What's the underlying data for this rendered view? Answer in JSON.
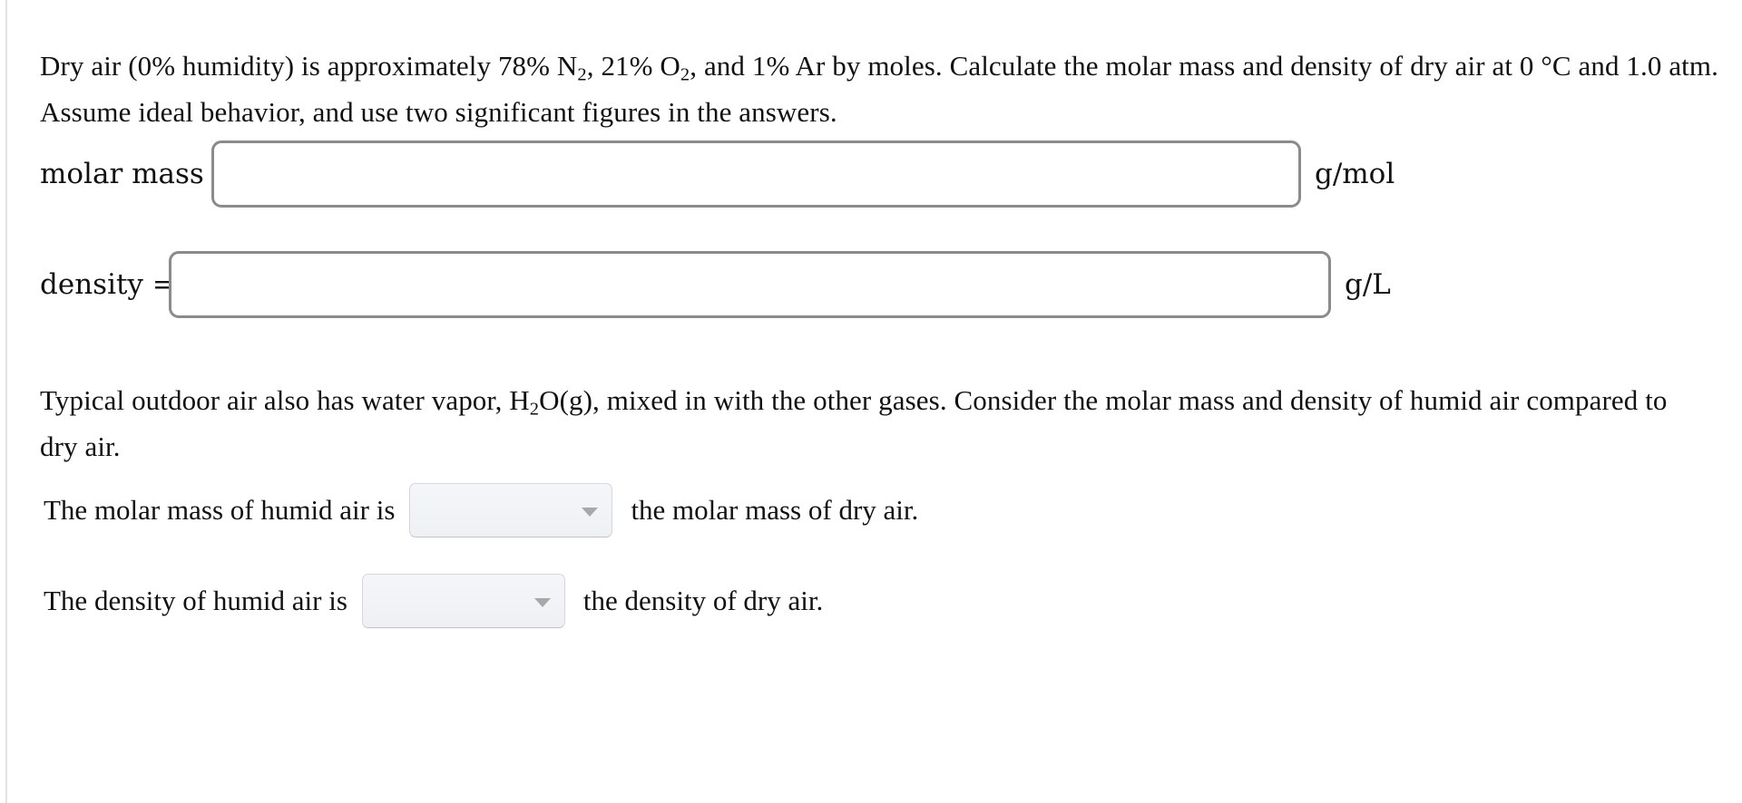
{
  "problem": {
    "intro_paragraph": {
      "segment_1": "Dry air (0% humidity) is approximately 78% N",
      "sub_1": "2",
      "segment_2": ", 21% O",
      "sub_2": "2",
      "segment_3": ", and 1% Ar by moles. Calculate the molar mass and density of dry air at 0 °C and 1.0 atm. Assume ideal behavior, and use two significant figures in the answers."
    },
    "humid_paragraph": {
      "segment_1": "Typical outdoor air also has water vapor, H",
      "sub_1": "2",
      "segment_2": "O(g), mixed in with the other gases. Consider the molar mass and density of humid air compared to dry air."
    }
  },
  "answers": {
    "molar_mass": {
      "label": "molar mass =",
      "value": "",
      "placeholder": "",
      "unit": "g/mol"
    },
    "density": {
      "label": "density =",
      "value": "",
      "placeholder": "",
      "unit": "g/L"
    }
  },
  "comparisons": [
    {
      "lead_text": "The molar mass of humid air is",
      "selected": "",
      "trail_text": "the molar mass of dry air.",
      "arrow_icon": "chevron-down-icon"
    },
    {
      "lead_text": "The density of humid air is",
      "selected": "",
      "trail_text": "the density of dry air.",
      "arrow_icon": "chevron-down-icon"
    }
  ],
  "colors": {
    "page_background": "#ffffff",
    "text": "#111111",
    "input_border": "#8b8b8b",
    "select_fill": "#eff1f5",
    "select_border": "#d4d7de",
    "select_arrow": "#a8a8a8",
    "left_rule": "#e3e3e6"
  }
}
